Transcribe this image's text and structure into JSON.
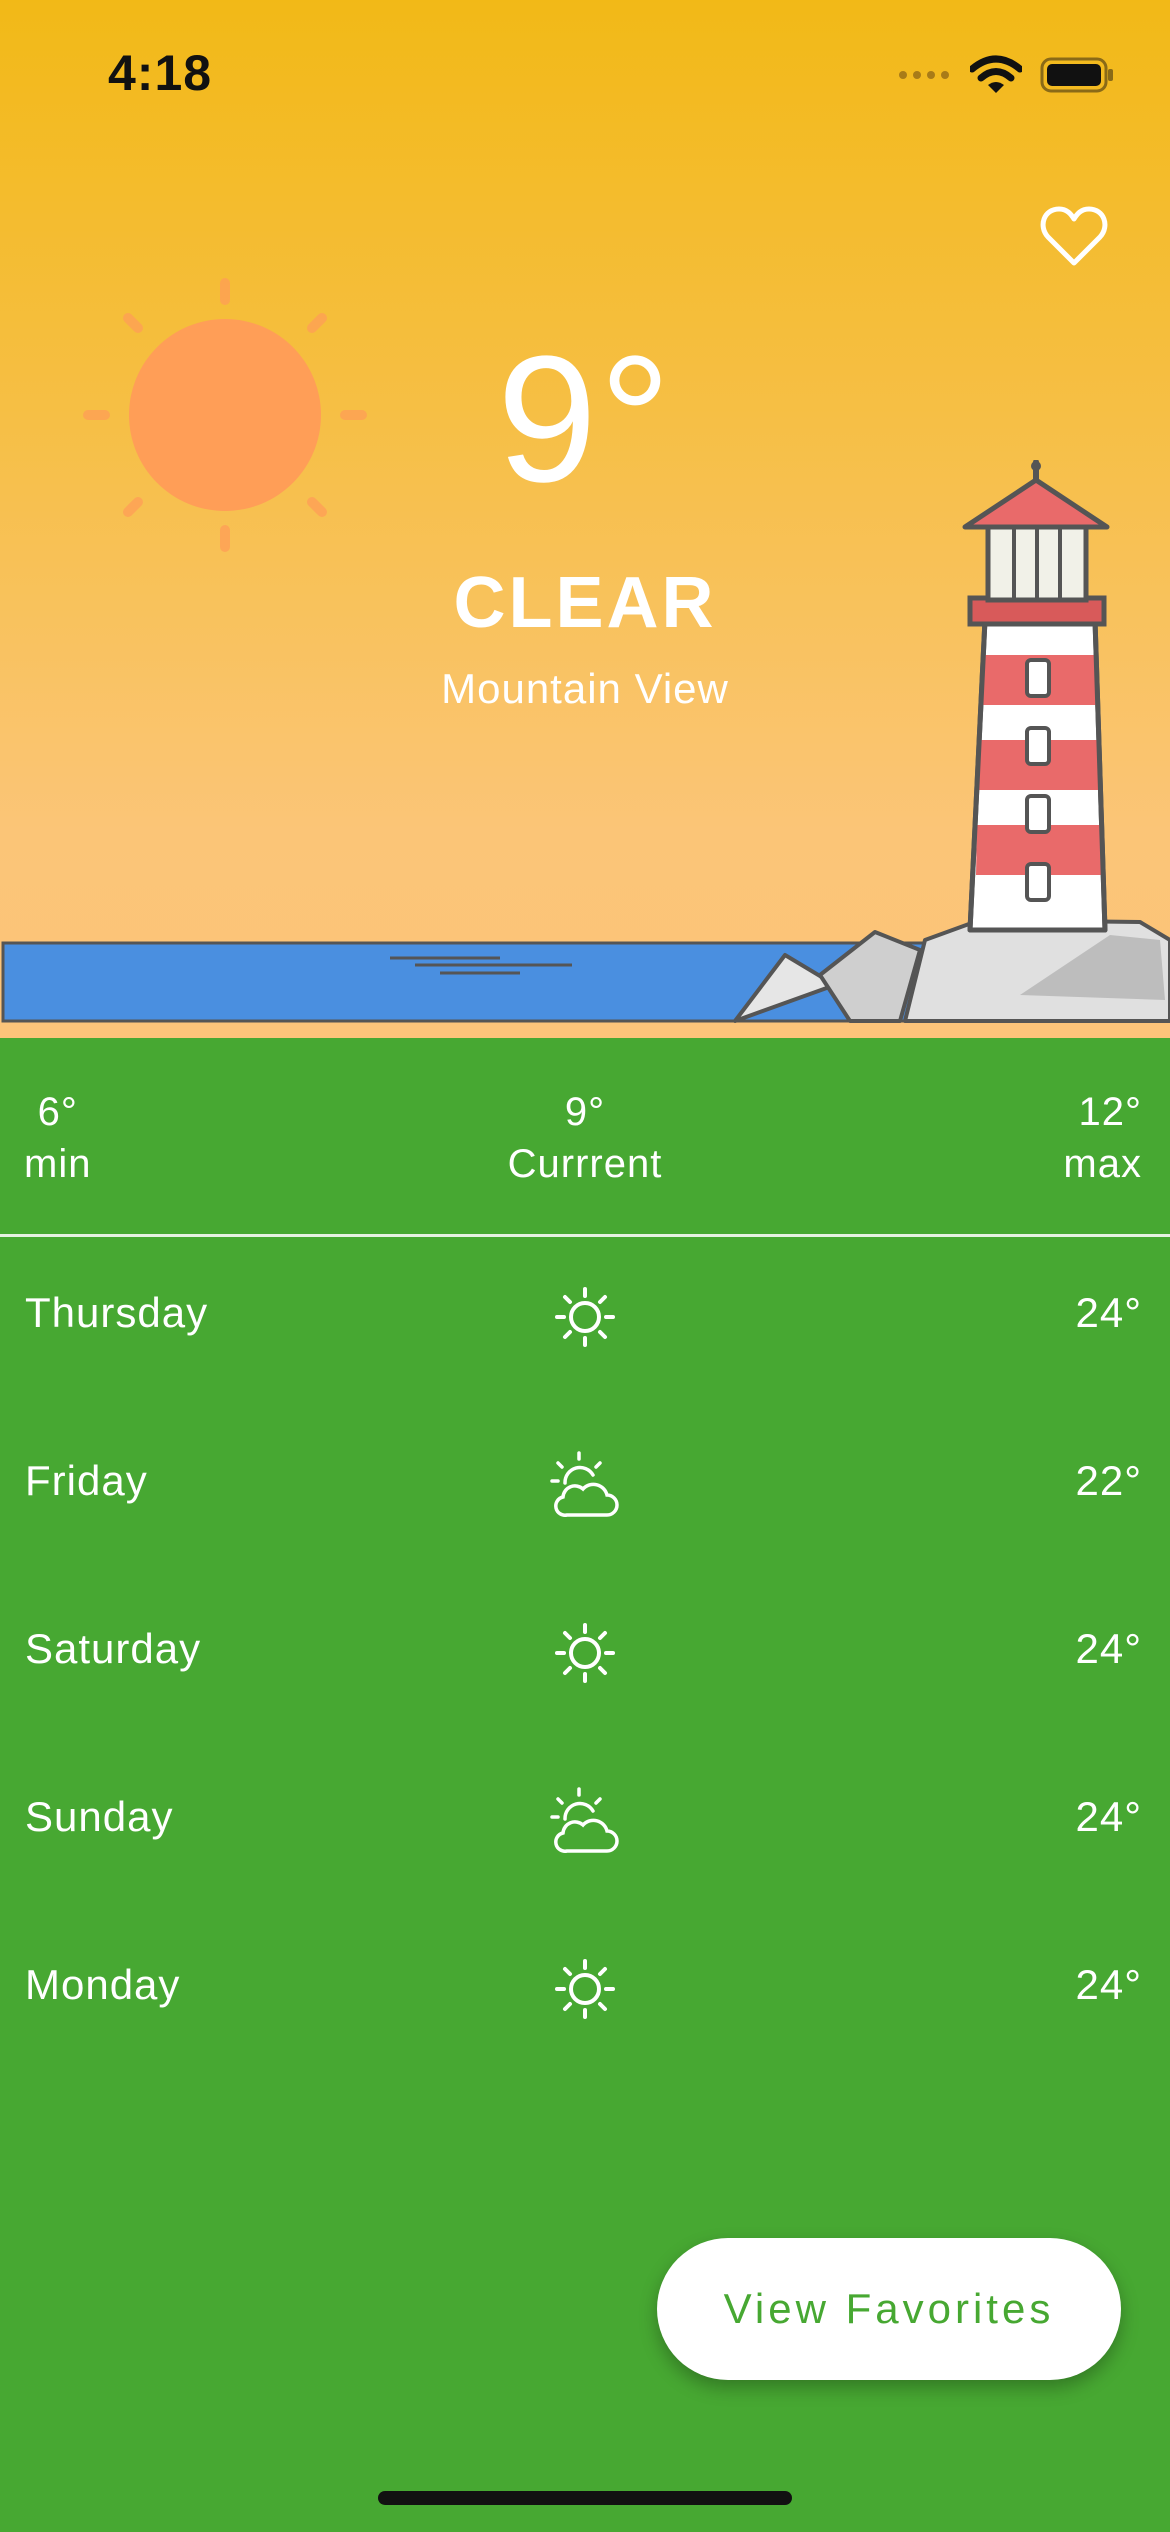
{
  "status_bar": {
    "time": "4:18",
    "icons": [
      "signal-icon",
      "wifi-icon",
      "battery-icon"
    ]
  },
  "hero": {
    "favorite_icon": "heart-icon",
    "temperature": "9°",
    "condition": "CLEAR",
    "city": "Mountain View"
  },
  "summary": {
    "min_value": "6°",
    "min_label": "min",
    "current_value": "9°",
    "current_label": "Currrent",
    "max_value": "12°",
    "max_label": "max"
  },
  "forecast": [
    {
      "day": "Thursday",
      "icon": "sun-icon",
      "temp": "24°"
    },
    {
      "day": "Friday",
      "icon": "partly-cloudy-icon",
      "temp": "22°"
    },
    {
      "day": "Saturday",
      "icon": "sun-icon",
      "temp": "24°"
    },
    {
      "day": "Sunday",
      "icon": "partly-cloudy-icon",
      "temp": "24°"
    },
    {
      "day": "Monday",
      "icon": "sun-icon",
      "temp": "24°"
    }
  ],
  "fab": {
    "label": "View Favorites"
  },
  "colors": {
    "background_green": "#47a832",
    "sky_top": "#f2b917",
    "sky_bottom": "#fcc47a",
    "sea": "#4a8fe0",
    "sun": "#ff9e57"
  }
}
